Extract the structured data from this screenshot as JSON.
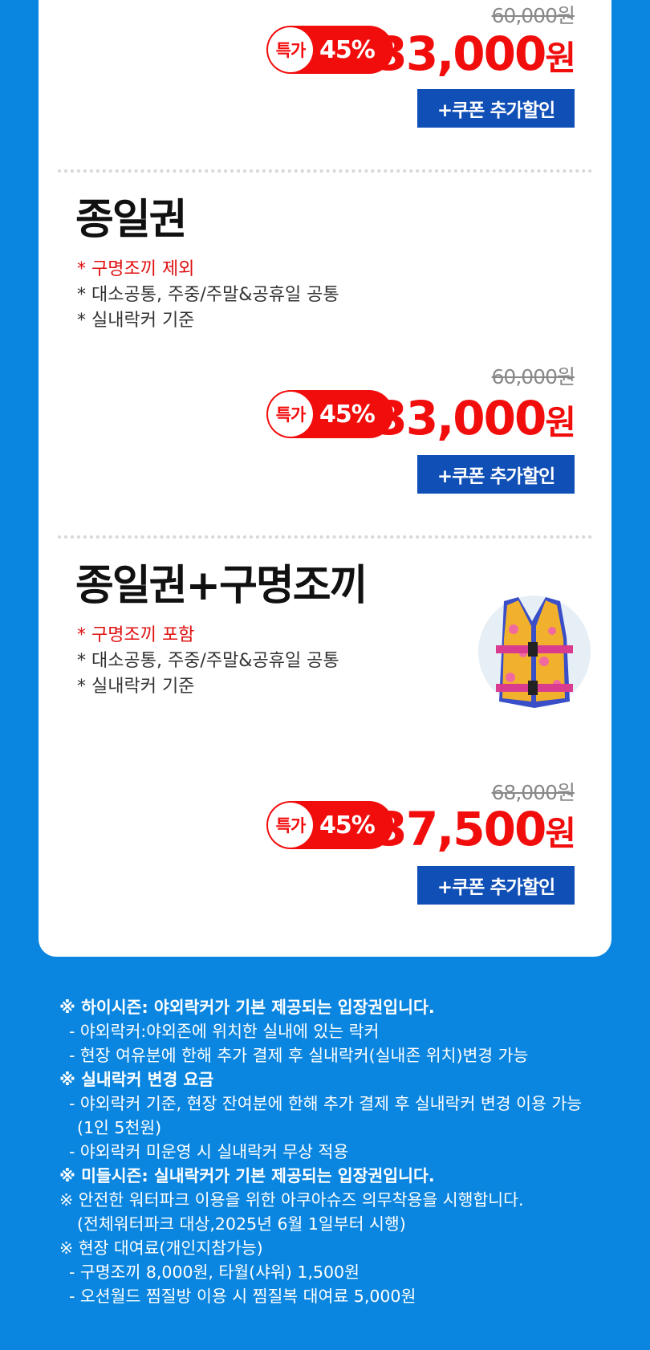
{
  "tickets": [
    {
      "title": "",
      "notes": [],
      "original_price": "60,000원",
      "badge_label": "특가",
      "discount": "45%",
      "price": "33,000",
      "price_unit": "원",
      "coupon": "+쿠폰 추가할인"
    },
    {
      "title": "종일권",
      "notes": [
        "* 구명조끼 제외",
        "* 대소공통, 주중/주말&공휴일 공통",
        "* 실내락커 기준"
      ],
      "original_price": "60,000원",
      "badge_label": "특가",
      "discount": "45%",
      "price": "33,000",
      "price_unit": "원",
      "coupon": "+쿠폰 추가할인"
    },
    {
      "title": "종일권+구명조끼",
      "notes": [
        "* 구명조끼 포함",
        "* 대소공통, 주중/주말&공휴일 공통",
        "* 실내락커 기준"
      ],
      "original_price": "68,000원",
      "badge_label": "특가",
      "discount": "45%",
      "price": "37,500",
      "price_unit": "원",
      "coupon": "+쿠폰 추가할인",
      "image": "life-vest"
    }
  ],
  "info": [
    "※ 하이시즌: 야외락커가 기본 제공되는 입장권입니다.",
    "- 야외락커:야외존에 위치한 실내에 있는 락커",
    "- 현장 여유분에 한해 추가 결제 후 실내락커(실내존 위치)변경 가능",
    "※ 실내락커 변경 요금",
    "- 야외락커 기준, 현장 잔여분에 한해 추가 결제 후 실내락커 변경 이용 가능",
    "(1인 5천원)",
    "- 야외락커 미운영 시 실내락커 무상 적용",
    "※ 미들시즌: 실내락커가 기본 제공되는 입장권입니다.",
    "※ 안전한 워터파크 이용을 위한 아쿠아슈즈 의무착용을 시행합니다.",
    "(전체워터파크 대상,2025년 6월 1일부터 시행)",
    "※ 현장 대여료(개인지참가능)",
    "- 구명조끼 8,000원, 타월(샤워) 1,500원",
    "- 오션월드 찜질방 이용 시 찜질복 대여료 5,000원"
  ],
  "colors": {
    "background": "#0a86e0",
    "accent_red": "#f20d0d",
    "coupon_blue": "#0f4fb6"
  }
}
